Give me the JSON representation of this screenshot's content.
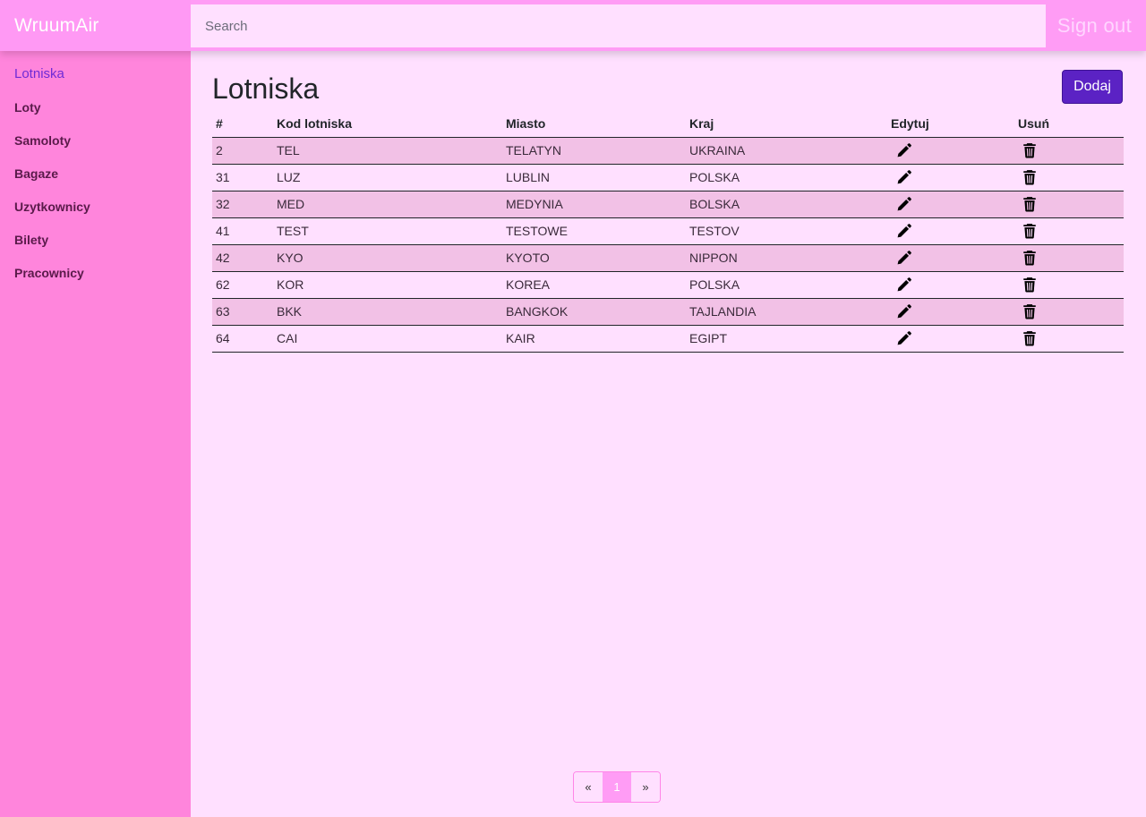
{
  "app": {
    "brand": "WruumAir",
    "search_placeholder": "Search",
    "signout": "Sign out"
  },
  "sidebar": {
    "items": [
      {
        "label": "Lotniska",
        "active": true
      },
      {
        "label": "Loty",
        "active": false
      },
      {
        "label": "Samoloty",
        "active": false
      },
      {
        "label": "Bagaze",
        "active": false
      },
      {
        "label": "Uzytkownicy",
        "active": false
      },
      {
        "label": "Bilety",
        "active": false
      },
      {
        "label": "Pracownicy",
        "active": false
      }
    ]
  },
  "main": {
    "title": "Lotniska",
    "add_label": "Dodaj",
    "table": {
      "headers": [
        "#",
        "Kod lotniska",
        "Miasto",
        "Kraj",
        "Edytuj",
        "Usuń"
      ],
      "rows": [
        [
          "2",
          "TEL",
          "TELATYN",
          "UKRAINA"
        ],
        [
          "31",
          "LUZ",
          "LUBLIN",
          "POLSKA"
        ],
        [
          "32",
          "MED",
          "MEDYNIA",
          "BOLSKA"
        ],
        [
          "41",
          "TEST",
          "TESTOWE",
          "TESTOV"
        ],
        [
          "42",
          "KYO",
          "KYOTO",
          "NIPPON"
        ],
        [
          "62",
          "KOR",
          "KOREA",
          "POLSKA"
        ],
        [
          "63",
          "BKK",
          "BANGKOK",
          "TAJLANDIA"
        ],
        [
          "64",
          "CAI",
          "KAIR",
          "EGIPT"
        ]
      ]
    },
    "pagination": {
      "prev": "«",
      "current": "1",
      "next": "»"
    }
  },
  "icons": {
    "edit": "pencil-icon",
    "delete": "trash-icon"
  },
  "colors": {
    "topbar": "#ff9cf5",
    "sidebar": "#ff85dc",
    "content_bg": "#ffe0ff",
    "row_stripe": "#f2c1e6",
    "accent": "#5b22c4",
    "active_nav": "#6f2bd6"
  }
}
